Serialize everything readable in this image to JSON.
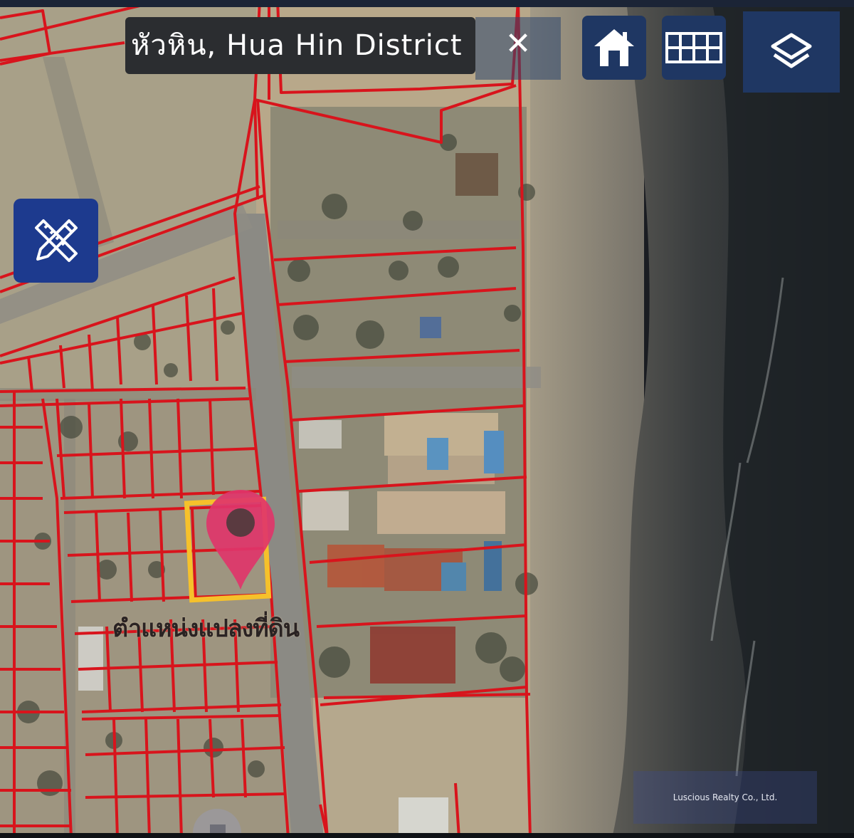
{
  "search": {
    "value": "หัวหิน, Hua Hin District"
  },
  "toolbar": {
    "close_label": "✕"
  },
  "map": {
    "parcel_label": "ตำแหน่งแปลงที่ดิน",
    "watermark": "Luscious Realty Co., Ltd."
  },
  "colors": {
    "parcel_lines": "#d8141c",
    "selection": "#f6c12b",
    "pin": "#e0356a",
    "button_bg": "#1f3763",
    "measure_bg": "#1d3a8e"
  },
  "icons": [
    "home-icon",
    "grid-icon",
    "layers-icon",
    "ruler-pencil-icon",
    "location-pin-icon",
    "close-icon"
  ]
}
